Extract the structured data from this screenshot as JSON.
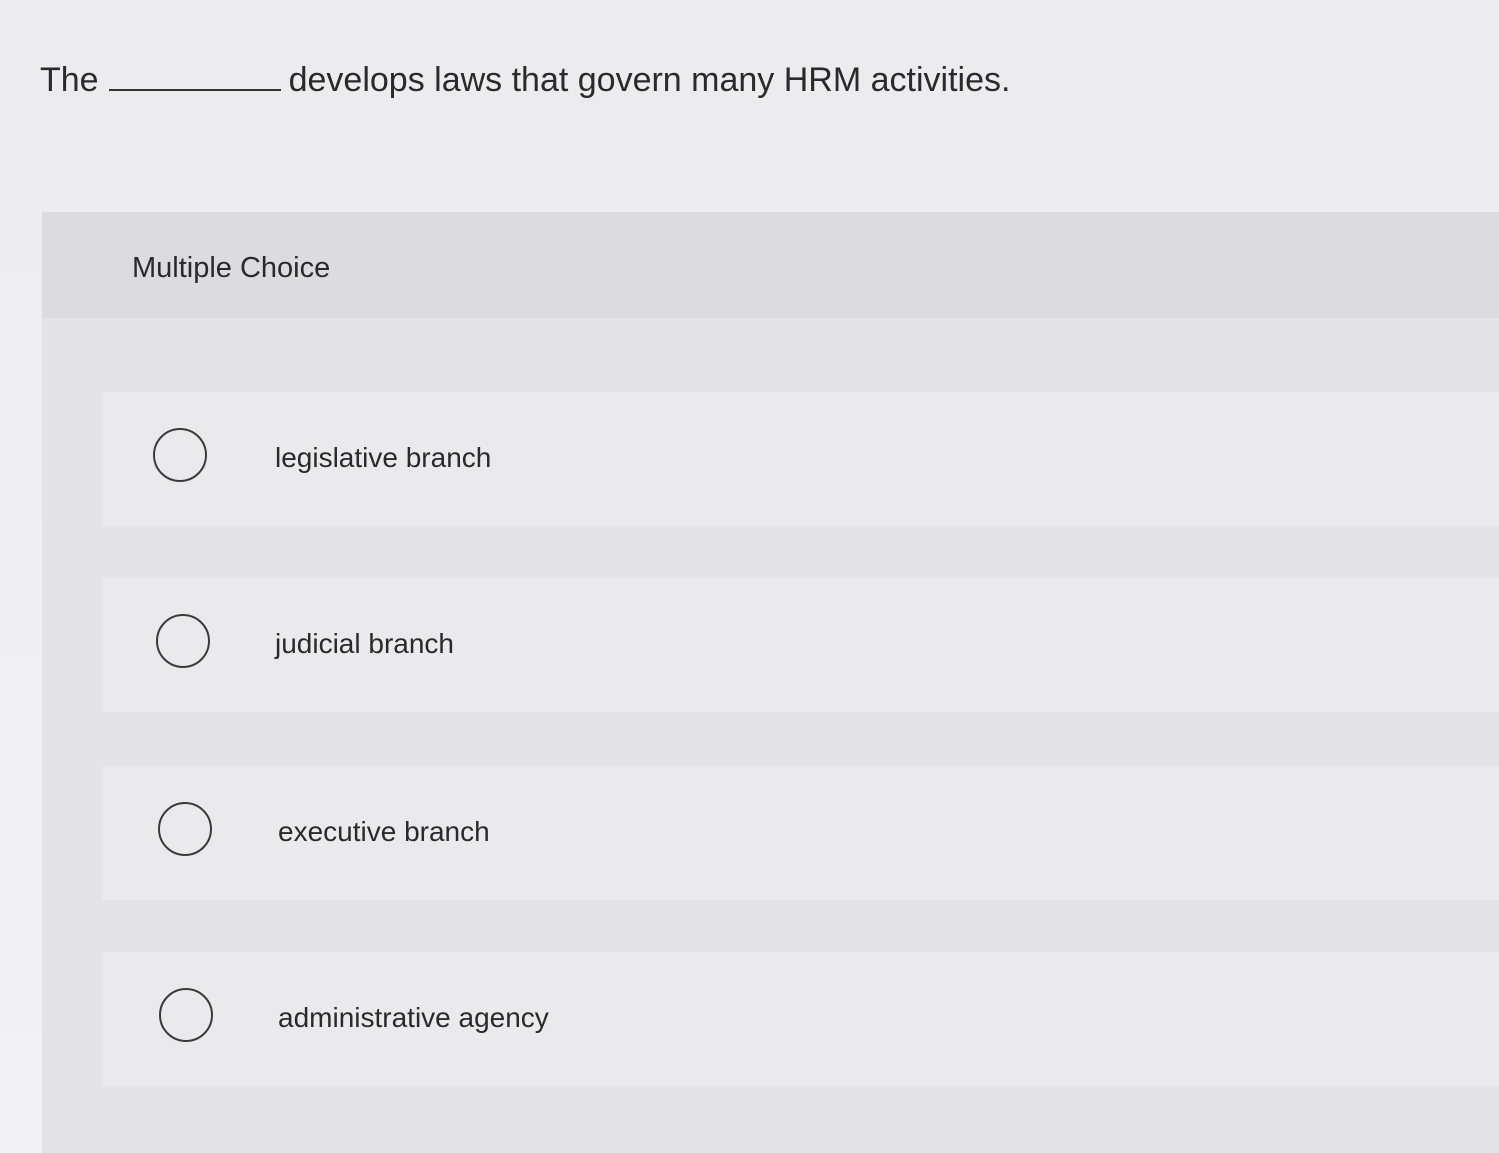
{
  "question": {
    "before_blank": "The",
    "after_blank": "develops laws that govern many HRM activities."
  },
  "panel": {
    "title": "Multiple Choice"
  },
  "options": [
    {
      "label": "legislative branch",
      "selected": false
    },
    {
      "label": "judicial branch",
      "selected": false
    },
    {
      "label": "executive branch",
      "selected": false
    },
    {
      "label": "administrative agency",
      "selected": false
    }
  ]
}
